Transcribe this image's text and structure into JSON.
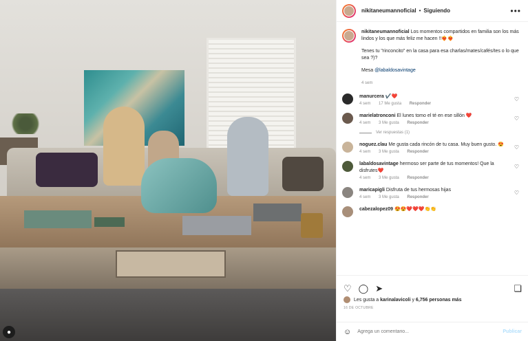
{
  "post": {
    "username": "nikitaneumannoficial",
    "separator": "•",
    "following_label": "Siguiendo",
    "more_icon": "more-horizontal-icon",
    "user_tag_icon": "user-tag-icon"
  },
  "caption": {
    "username": "nikitaneumannoficial",
    "text_p1": "Los momentos compartidos en familia son los más lindos y los que más feliz me hacen !!❤️‍🔥❤️‍🔥",
    "text_p2": "Tenes tu \"rinconcito\" en la casa para esa charlas/mates/cafés/tes o lo que sea ?)?",
    "mesa_label": "Mesa",
    "mesa_link": "@labaldosavintage",
    "time": "4 sem"
  },
  "comments": [
    {
      "user": "manurcera",
      "text": "✔️❤️",
      "time": "4 sem",
      "likes": "17 Me gusta",
      "reply": "Responder",
      "avatar_color": "#2a2a2a"
    },
    {
      "user": "marielatronconi",
      "text": "El lunes tomo el té en ese sillón ❤️",
      "time": "4 sem",
      "likes": "3 Me gusta",
      "reply": "Responder",
      "avatar_color": "#6b5a4e"
    },
    {
      "user": "noguez.clau",
      "text": "Me gusta cada rincón de tu casa. Muy buen gusto. 😍",
      "time": "4 sem",
      "likes": "3 Me gusta",
      "reply": "Responder",
      "avatar_color": "#c9b49a"
    },
    {
      "user": "labaldosavintage",
      "text": "hermoso ser parte de tus momentos! Que la disfrutes❤️",
      "time": "4 sem",
      "likes": "3 Me gusta",
      "reply": "Responder",
      "avatar_color": "#4e5a3a"
    },
    {
      "user": "maricapigli",
      "text": "Disfruta de tus hermosas hijas",
      "time": "4 sem",
      "likes": "3 Me gusta",
      "reply": "Responder",
      "avatar_color": "#8a8580"
    },
    {
      "user": "cabezalopez09",
      "text": "😍😍❤️❤️❤️👏👏",
      "avatar_color": "#a88f7a"
    }
  ],
  "replies_label": "Ver respuestas (1)",
  "actions": {
    "like_icon": "heart-icon",
    "comment_icon": "comment-icon",
    "share_icon": "share-icon",
    "save_icon": "bookmark-icon"
  },
  "likes": {
    "prefix": "Les gusta a",
    "user": "karinalavicoli",
    "middle": "y",
    "count": "6,756 personas más"
  },
  "date": "16 DE OCTUBRE",
  "comment_input": {
    "placeholder": "Agrega un comentario...",
    "publish_label": "Publicar",
    "emoji_icon": "emoji-icon"
  }
}
